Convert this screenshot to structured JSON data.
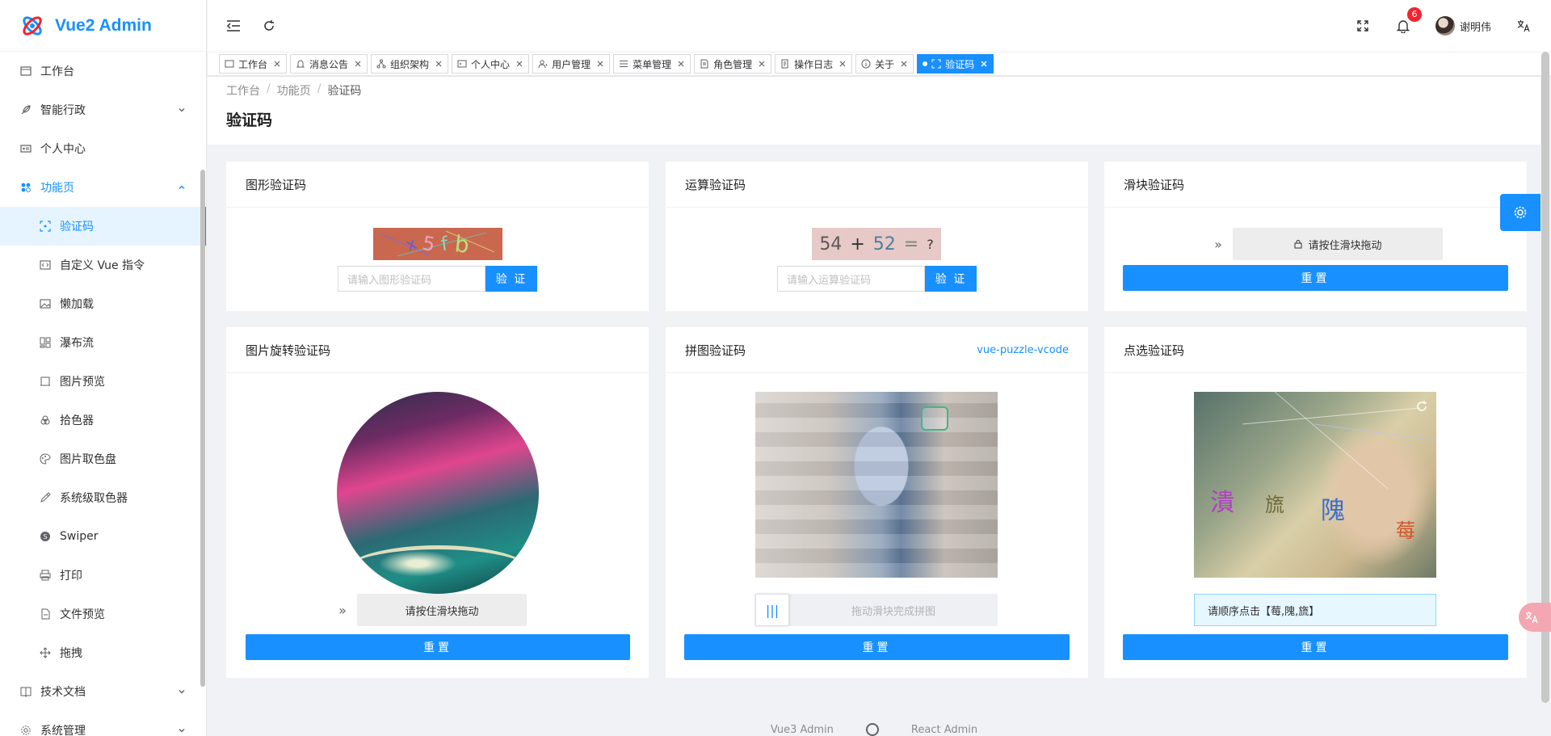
{
  "app": {
    "title": "Vue2 Admin"
  },
  "sidebar": {
    "items": [
      {
        "label": "工作台",
        "icon": "dashboard-icon"
      },
      {
        "label": "智能行政",
        "icon": "feather-icon"
      },
      {
        "label": "个人中心",
        "icon": "id-card-icon"
      },
      {
        "label": "功能页",
        "icon": "apps-icon"
      },
      {
        "label": "验证码",
        "icon": "scan-icon"
      },
      {
        "label": "自定义 Vue 指令",
        "icon": "code-icon"
      },
      {
        "label": "懒加载",
        "icon": "image-icon"
      },
      {
        "label": "瀑布流",
        "icon": "waterfall-icon"
      },
      {
        "label": "图片预览",
        "icon": "picture-icon"
      },
      {
        "label": "拾色器",
        "icon": "palette-icon"
      },
      {
        "label": "图片取色盘",
        "icon": "color-plate-icon"
      },
      {
        "label": "系统级取色器",
        "icon": "eyedropper-icon"
      },
      {
        "label": "Swiper",
        "icon": "swiper-icon"
      },
      {
        "label": "打印",
        "icon": "printer-icon"
      },
      {
        "label": "文件预览",
        "icon": "file-icon"
      },
      {
        "label": "拖拽",
        "icon": "drag-icon"
      },
      {
        "label": "技术文档",
        "icon": "book-icon"
      },
      {
        "label": "系统管理",
        "icon": "gear-icon"
      }
    ]
  },
  "header": {
    "notification_count": "6",
    "user_name": "谢明伟"
  },
  "tabs": [
    {
      "label": "工作台"
    },
    {
      "label": "消息公告"
    },
    {
      "label": "组织架构"
    },
    {
      "label": "个人中心"
    },
    {
      "label": "用户管理"
    },
    {
      "label": "菜单管理"
    },
    {
      "label": "角色管理"
    },
    {
      "label": "操作日志"
    },
    {
      "label": "关于"
    },
    {
      "label": "验证码"
    }
  ],
  "breadcrumb": [
    "工作台",
    "功能页",
    "验证码"
  ],
  "breadcrumb_sep": "/",
  "page_title": "验证码",
  "cards": {
    "graphic": {
      "title": "图形验证码",
      "captcha_chars": [
        "x",
        "5",
        "f",
        "b"
      ],
      "placeholder": "请输入图形验证码",
      "button": "验 证"
    },
    "math": {
      "title": "运算验证码",
      "expression": [
        "54",
        "+",
        "52",
        "=",
        "?"
      ],
      "placeholder": "请输入运算验证码",
      "button": "验 证"
    },
    "slider": {
      "title": "滑块验证码",
      "arrow": "»",
      "hint": "请按住滑块拖动",
      "reset": "重置"
    },
    "rotate": {
      "title": "图片旋转验证码",
      "arrow": "»",
      "hint": "请按住滑块拖动",
      "reset": "重置"
    },
    "puzzle": {
      "title": "拼图验证码",
      "link": "vue-puzzle-vcode",
      "handle": "|||",
      "hint": "拖动滑块完成拼图",
      "reset": "重置"
    },
    "click": {
      "title": "点选验证码",
      "chars": [
        "潰",
        "旒",
        "隗",
        "莓"
      ],
      "hint": "请顺序点击【莓,隗,旒】",
      "reset": "重置"
    }
  },
  "footer": {
    "left": "Vue3 Admin",
    "right": "React Admin"
  },
  "colors": {
    "primary": "#1890ff",
    "badge": "#f5222d"
  }
}
